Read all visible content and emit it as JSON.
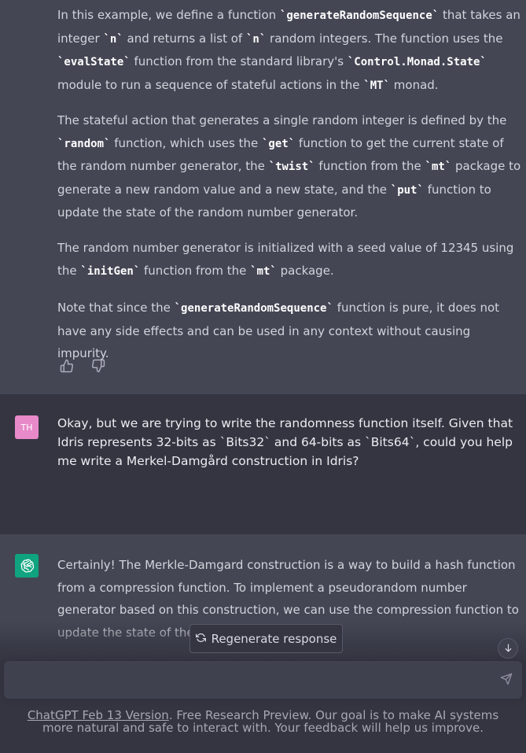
{
  "previous_response": {
    "paragraphs": [
      [
        {
          "t": "In this example, we define a function "
        },
        {
          "c": "`generateRandomSequence`"
        },
        {
          "t": " that takes an integer "
        },
        {
          "c": "`n`"
        },
        {
          "t": " and returns a list of "
        },
        {
          "c": "`n`"
        },
        {
          "t": " random integers. The function uses the "
        },
        {
          "c": "`evalState`"
        },
        {
          "t": " function from the standard library's "
        },
        {
          "c": "`Control.Monad.State`"
        },
        {
          "t": " module to run a sequence of stateful actions in the "
        },
        {
          "c": "`MT`"
        },
        {
          "t": " monad."
        }
      ],
      [
        {
          "t": "The stateful action that generates a single random integer is defined by the "
        },
        {
          "c": "`random`"
        },
        {
          "t": " function, which uses the "
        },
        {
          "c": "`get`"
        },
        {
          "t": " function to get the current state of the random number generator, the "
        },
        {
          "c": "`twist`"
        },
        {
          "t": " function from the "
        },
        {
          "c": "`mt`"
        },
        {
          "t": " package to generate a new random value and a new state, and the "
        },
        {
          "c": "`put`"
        },
        {
          "t": " function to update the state of the random number generator."
        }
      ],
      [
        {
          "t": "The random number generator is initialized with a seed value of 12345 using the "
        },
        {
          "c": "`initGen`"
        },
        {
          "t": " function from the "
        },
        {
          "c": "`mt`"
        },
        {
          "t": " package."
        }
      ],
      [
        {
          "t": "Note that since the "
        },
        {
          "c": "`generateRandomSequence`"
        },
        {
          "t": " function is pure, it does not have any side effects and can be used in any context without causing impurity."
        }
      ]
    ]
  },
  "user_message": {
    "avatar_initials": "TH",
    "text": "Okay, but we are trying to write the randomness function itself. Given that Idris represents 32-bits as `Bits32` and 64-bits as `Bits64`, could you help me write a Merkel-Damgård construction in Idris?"
  },
  "assistant_message": {
    "text": "Certainly! The Merkle-Damgard construction is a way to build a hash function from a compression function. To implement a pseudorandom number generator based on this construction, we can use the compression function to update the state of the generator and produ"
  },
  "regenerate": {
    "label": "Regenerate response"
  },
  "input": {
    "value": ""
  },
  "footer": {
    "link": "ChatGPT Feb 13 Version",
    "text": ". Free Research Preview. Our goal is to make AI systems more natural and safe to interact with. Your feedback will help us improve."
  },
  "icons": {
    "thumbs_up": "thumbs-up-icon",
    "thumbs_down": "thumbs-down-icon",
    "regenerate": "refresh-icon",
    "scroll_down": "arrow-down-icon",
    "send": "send-icon",
    "assistant_logo": "openai-logo-icon"
  },
  "colors": {
    "assistant_bg": "#444654",
    "user_bg": "#343541",
    "user_avatar": "#e889c9",
    "assistant_avatar": "#10a37f"
  }
}
